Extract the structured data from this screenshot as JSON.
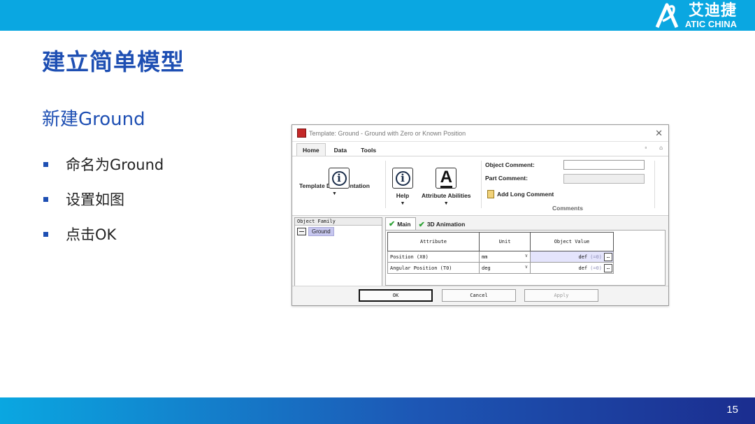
{
  "brand": {
    "cn": "艾迪捷",
    "en": "ATIC CHINA",
    "color": "#0aa7e1"
  },
  "slide": {
    "title": "建立简单模型",
    "subtitle": "新建Ground",
    "bullets": [
      "命名为Ground",
      "设置如图",
      "点击OK"
    ],
    "page_number": "15",
    "accent": "#1e4fb3"
  },
  "dialog": {
    "title": "Template: Ground - Ground with Zero or Known Position",
    "tabs": [
      "Home",
      "Data",
      "Tools"
    ],
    "ribbon": {
      "buttons": [
        {
          "label": "Template Documentation",
          "icon": "info-icon"
        },
        {
          "label": "Help",
          "icon": "info-icon"
        },
        {
          "label": "Attribute Abilities",
          "icon": "text-format-icon"
        }
      ],
      "object_comment_label": "Object Comment:",
      "object_comment_value": "",
      "part_comment_label": "Part Comment:",
      "part_comment_value": "",
      "long_comment_label": "Add Long Comment",
      "comments_caption": "Comments"
    },
    "object_family": {
      "header": "Object Family",
      "items": [
        "Ground"
      ]
    },
    "panel_tabs": [
      "Main",
      "3D Animation"
    ],
    "table": {
      "headers": [
        "Attribute",
        "Unit",
        "Object Value"
      ],
      "rows": [
        {
          "attribute": "Position (X0)",
          "unit": "mm",
          "value": "def",
          "hint": "(=0)"
        },
        {
          "attribute": "Angular Position (T0)",
          "unit": "deg",
          "value": "def",
          "hint": "(=0)"
        }
      ]
    },
    "buttons": {
      "ok": "OK",
      "cancel": "Cancel",
      "apply": "Apply"
    }
  }
}
